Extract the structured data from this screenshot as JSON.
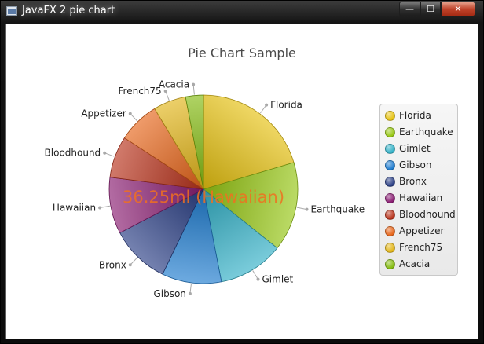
{
  "window": {
    "title": "JavaFX 2 pie chart",
    "min_glyph": "—",
    "max_glyph": "☐",
    "close_glyph": "✕"
  },
  "chart_data": {
    "type": "pie",
    "title": "Pie Chart Sample",
    "categories": [
      "Florida",
      "Earthquake",
      "Gimlet",
      "Gibson",
      "Bronx",
      "Hawaiian",
      "Bloodhound",
      "Appetizer",
      "French75",
      "Acacia"
    ],
    "values": [
      20,
      15,
      11,
      10,
      10,
      9.5,
      7,
      7,
      5.5,
      3
    ],
    "colors": [
      "#e6c211",
      "#97c714",
      "#33b1c7",
      "#1f7ccf",
      "#2b3f85",
      "#8a1d72",
      "#b8321b",
      "#e6651a",
      "#e2b518",
      "#84bb10"
    ],
    "legend_position": "right",
    "tooltip": "36.25ml (Hawaiian)",
    "tooltip_color": "#f07020"
  }
}
